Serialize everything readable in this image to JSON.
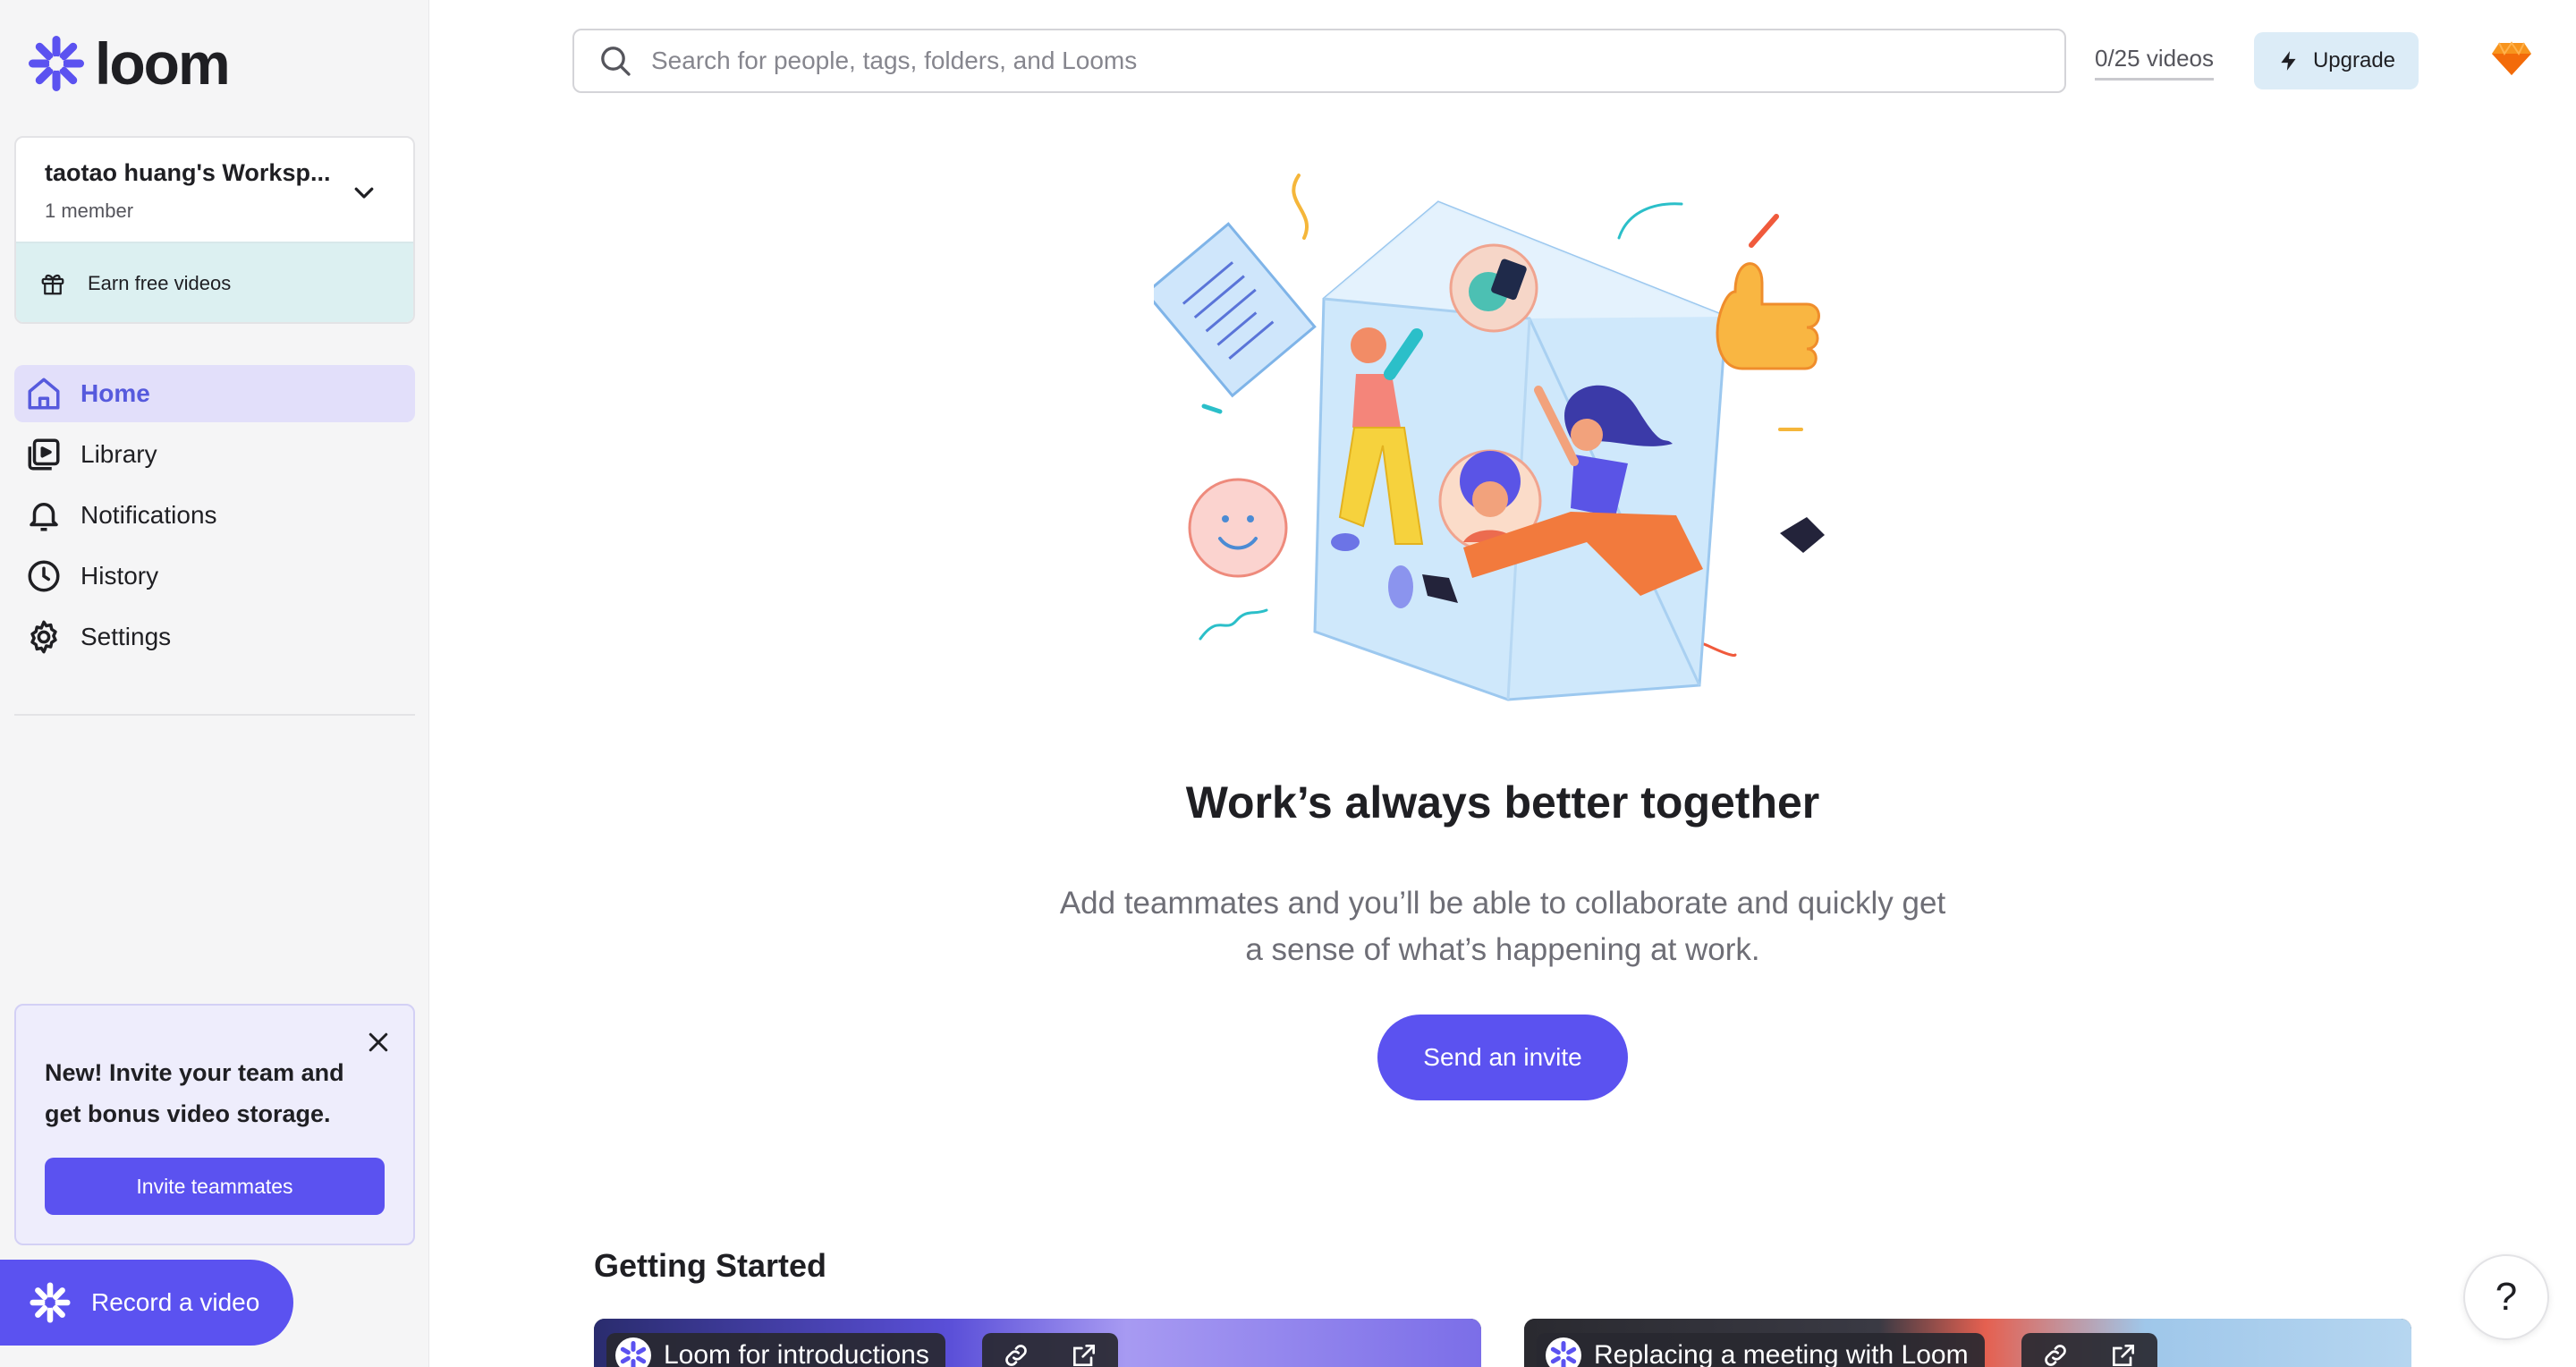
{
  "brand": {
    "name": "loom",
    "accent": "#5B52F0"
  },
  "workspace": {
    "name": "taotao huang's Worksp...",
    "members": "1 member",
    "earn_label": "Earn free videos"
  },
  "nav": [
    {
      "label": "Home",
      "icon": "home-icon",
      "active": true
    },
    {
      "label": "Library",
      "icon": "library-icon",
      "active": false
    },
    {
      "label": "Notifications",
      "icon": "bell-icon",
      "active": false
    },
    {
      "label": "History",
      "icon": "clock-icon",
      "active": false
    },
    {
      "label": "Settings",
      "icon": "gear-icon",
      "active": false
    }
  ],
  "promo": {
    "text": "New! Invite your team and get bonus video storage.",
    "button_label": "Invite teammates"
  },
  "record_button": {
    "label": "Record a video"
  },
  "topbar": {
    "search_placeholder": "Search for people, tags, folders, and Looms",
    "video_count": "0/25 videos",
    "upgrade_label": "Upgrade"
  },
  "hero": {
    "title": "Work’s always better together",
    "subtitle": "Add teammates and you’ll be able to collaborate and quickly get a sense of what’s happening at work.",
    "button_label": "Send an invite"
  },
  "getting_started": {
    "heading": "Getting Started",
    "videos": [
      {
        "title": "Loom for introductions"
      },
      {
        "title": "Replacing a meeting with Loom"
      }
    ]
  },
  "help": {
    "label": "?"
  }
}
